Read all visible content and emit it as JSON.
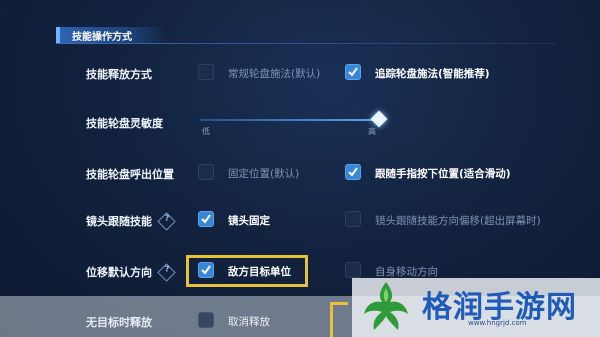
{
  "section": {
    "title": "技能操作方式"
  },
  "rows": [
    {
      "label": "技能释放方式",
      "options": [
        {
          "text": "常规轮盘施法(默认)",
          "checked": false
        },
        {
          "text": "追踪轮盘施法(智能推荐)",
          "checked": true
        }
      ]
    },
    {
      "label": "技能轮盘灵敏度",
      "slider": {
        "low": "低",
        "high": "高",
        "value": 1.0
      }
    },
    {
      "label": "技能轮盘呼出位置",
      "options": [
        {
          "text": "固定位置(默认)",
          "checked": false
        },
        {
          "text": "跟随手指按下位置(适合滑动)",
          "checked": true
        }
      ]
    },
    {
      "label": "镜头跟随技能",
      "options": [
        {
          "text": "镜头固定",
          "checked": true
        },
        {
          "text": "镜头跟随技能方向偏移(超出屏幕时)",
          "checked": false
        }
      ]
    },
    {
      "label": "位移默认方向",
      "options": [
        {
          "text": "敌方目标单位",
          "checked": true
        },
        {
          "text": "自身移动方向",
          "checked": false
        }
      ]
    },
    {
      "label": "无目标时释放",
      "options": [
        {
          "text": "取消释放",
          "checked": false
        }
      ]
    }
  ],
  "help_glyph": "?",
  "watermark": {
    "text": "格润手游网",
    "url": "www.hngrjd.com"
  },
  "colors": {
    "accent": "#3a86d6",
    "highlight": "#e6c23a",
    "background": "#13233f"
  }
}
